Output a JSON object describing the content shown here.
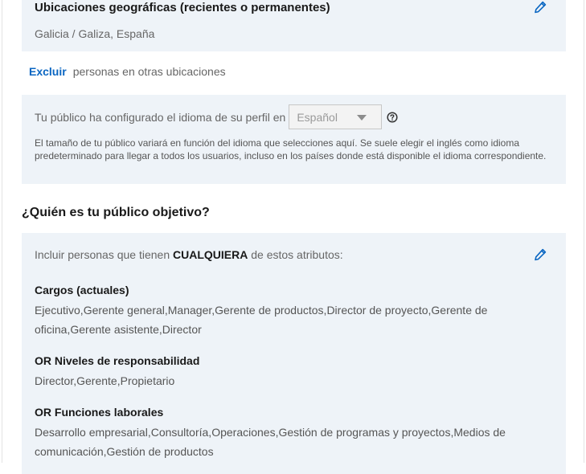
{
  "locations": {
    "title": "Ubicaciones geográficas (recientes o permanentes)",
    "value": "Galicia / Galiza, España",
    "edit_icon": "pencil-icon"
  },
  "exclude": {
    "link": "Excluir",
    "text": "personas en otras ubicaciones"
  },
  "language": {
    "prompt": "Tu público ha configurado el idioma de su perfil en",
    "selected": "Español",
    "help_icon": "question-circle-icon",
    "note": "El tamaño de tu público variará en función del idioma que selecciones aquí. Se suele elegir el inglés como idioma predeterminado para llegar a todos los usuarios, incluso en los países donde está disponible el idioma correspondiente."
  },
  "audience": {
    "section_title": "¿Quién es tu público objetivo?",
    "intro_prefix": "Incluir personas que tienen",
    "intro_strong": "CUALQUIERA",
    "intro_suffix": "de estos atributos:",
    "edit_icon": "pencil-icon",
    "attributes": [
      {
        "title": "Cargos (actuales)",
        "values": "Ejecutivo,Gerente general,Manager,Gerente de productos,Director de proyecto,Gerente de oficina,Gerente asistente,Director"
      },
      {
        "title": "OR Niveles de responsabilidad",
        "values": "Director,Gerente,Propietario"
      },
      {
        "title": "OR Funciones laborales",
        "values": "Desarrollo empresarial,Consultoría,Operaciones,Gestión de programas y proyectos,Medios de comunicación,Gestión de productos"
      }
    ]
  },
  "colors": {
    "accent": "#0a66c2",
    "panel_bg": "#eef3f8"
  }
}
